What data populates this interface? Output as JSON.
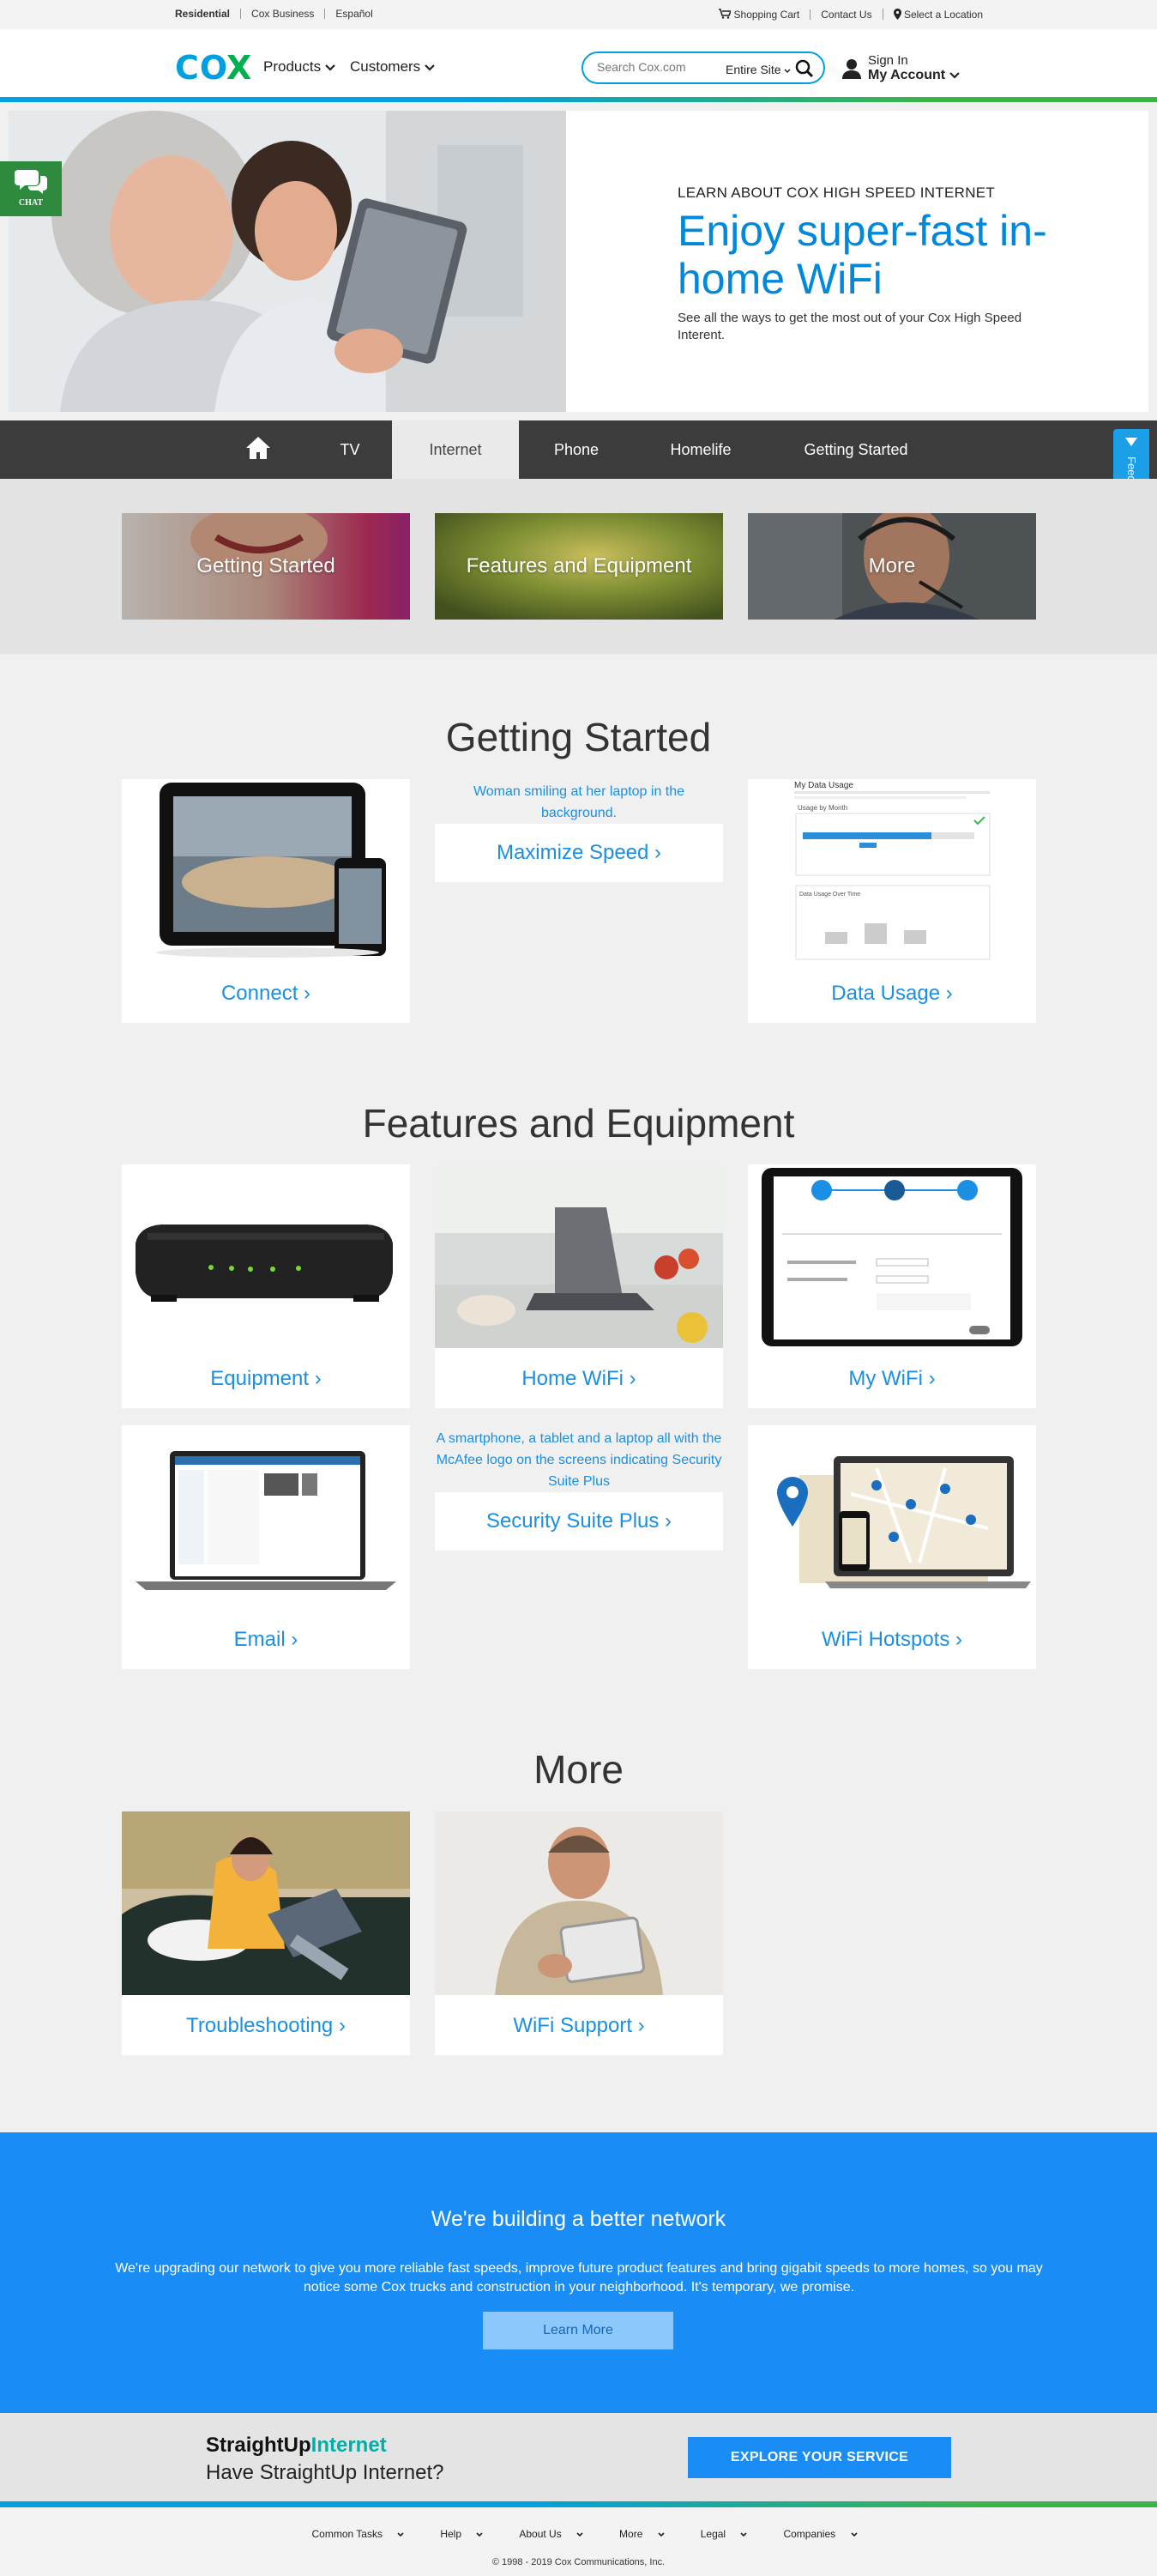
{
  "utility": {
    "segments": [
      "Residential",
      "Cox Business",
      "Español"
    ],
    "cart": "Shopping Cart",
    "contact": "Contact Us",
    "location": "Select a Location"
  },
  "header": {
    "logo": "COX",
    "nav": [
      "Products",
      "Customers"
    ],
    "search_placeholder": "Search Cox.com",
    "search_scope": "Entire Site",
    "sign_in": "Sign In",
    "my_account": "My Account"
  },
  "hero": {
    "eyebrow": "LEARN ABOUT COX HIGH SPEED INTERNET",
    "title": "Enjoy super-fast in-home WiFi",
    "body": "See all the ways to get the most out of your Cox High Speed Interent."
  },
  "chat_label": "CHAT",
  "feedback_label": "Feedback",
  "tabs": [
    {
      "label": "TV"
    },
    {
      "label": "Internet",
      "active": true
    },
    {
      "label": "Phone"
    },
    {
      "label": "Homelife"
    },
    {
      "label": "Getting Started"
    }
  ],
  "subcards": [
    "Getting Started",
    "Features and Equipment",
    "More"
  ],
  "getting_started": {
    "title": "Getting Started",
    "connect": "Connect ›",
    "alt_text": "Woman smiling at her laptop in the background.",
    "maximize": "Maximize Speed ›",
    "data_usage": "Data Usage ›",
    "data_usage_screen": {
      "heading": "My Data Usage",
      "sub": "Usage by Month",
      "chart": "Data Usage Over Time"
    }
  },
  "features": {
    "title": "Features and Equipment",
    "equipment": "Equipment ›",
    "home_wifi": "Home WiFi ›",
    "my_wifi": "My WiFi ›",
    "email": "Email ›",
    "security_alt": "A smartphone, a tablet and a laptop all with the McAfee logo on the screens indicating Security Suite Plus",
    "security": "Security Suite Plus ›",
    "hotspots": "WiFi Hotspots ›"
  },
  "more": {
    "title": "More",
    "troubleshooting": "Troubleshooting ›",
    "wifi_support": "WiFi Support ›"
  },
  "banner": {
    "title": "We're building a better network",
    "body": "We're upgrading our network to give you more reliable fast speeds, improve future product features and bring gigabit speeds to more homes, so you may notice some Cox trucks and construction in your neighborhood. It's temporary, we promise.",
    "button": "Learn More"
  },
  "straightup": {
    "brand_a": "StraightUp",
    "brand_b": "Internet",
    "question": "Have StraightUp Internet?",
    "button": "EXPLORE YOUR SERVICE"
  },
  "footer": {
    "links": [
      "Common Tasks",
      "Help",
      "About Us",
      "More",
      "Legal",
      "Companies"
    ],
    "copyright": "© 1998 - 2019 Cox Communications, Inc."
  },
  "colors": {
    "accent": "#1a8cf5",
    "brand_blue": "#00a0e0",
    "brand_green": "#3cb44b",
    "nav_dark": "#3c3c3c"
  }
}
